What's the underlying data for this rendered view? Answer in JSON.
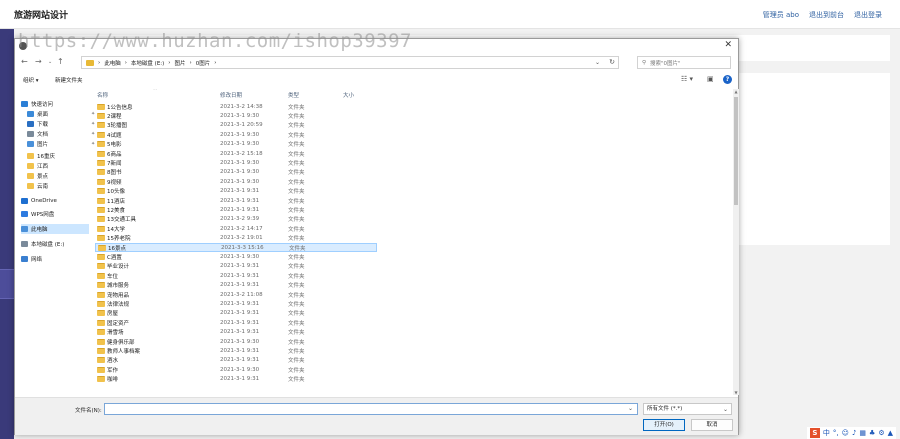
{
  "site": {
    "title": "旅游网站设计",
    "links": [
      "管理员 abo",
      "退出到前台",
      "退出登录"
    ]
  },
  "watermark": "https://www.huzhan.com/ishop39397",
  "dialog": {
    "address": {
      "crumbs": [
        "此电脑",
        "本地磁盘 (E:)",
        "图片",
        "0图片"
      ],
      "separator": "›"
    },
    "search_placeholder": "搜索\"0图片\"",
    "toolbar": {
      "organize": "组织 ▾",
      "new_folder": "新建文件夹"
    },
    "tree": [
      {
        "label": "快速访问",
        "icon": "star-icon",
        "color": "#2b7fd6",
        "indent": 0
      },
      {
        "label": "桌面",
        "icon": "desktop-icon",
        "color": "#3c8ad8",
        "indent": 1,
        "pinned": true
      },
      {
        "label": "下载",
        "icon": "download-icon",
        "color": "#2a6fc2",
        "indent": 1,
        "pinned": true
      },
      {
        "label": "文档",
        "icon": "document-icon",
        "color": "#7a8a9a",
        "indent": 1,
        "pinned": true
      },
      {
        "label": "图片",
        "icon": "picture-icon",
        "color": "#4a90d9",
        "indent": 1,
        "pinned": true
      },
      {
        "label": "16重庆",
        "icon": "folder-icon",
        "color": "#f1c24c",
        "indent": 1
      },
      {
        "label": "江西",
        "icon": "folder-icon",
        "color": "#f1c24c",
        "indent": 1
      },
      {
        "label": "景点",
        "icon": "folder-icon",
        "color": "#f1c24c",
        "indent": 1
      },
      {
        "label": "云南",
        "icon": "folder-icon",
        "color": "#f1c24c",
        "indent": 1
      },
      {
        "label": "OneDrive",
        "icon": "cloud-icon",
        "color": "#1e6fd0",
        "indent": 0
      },
      {
        "label": "WPS网盘",
        "icon": "cloud-icon",
        "color": "#2d7be0",
        "indent": 0
      },
      {
        "label": "此电脑",
        "icon": "computer-icon",
        "color": "#4a90d9",
        "indent": 0,
        "selected": true
      },
      {
        "label": "本地磁盘 (E:)",
        "icon": "drive-icon",
        "color": "#7a8a9a",
        "indent": 0
      },
      {
        "label": "网络",
        "icon": "network-icon",
        "color": "#3a7fd0",
        "indent": 0
      }
    ],
    "columns": [
      "名称",
      "修改日期",
      "类型",
      "大小"
    ],
    "rows": [
      {
        "name": "1公告信息",
        "date": "2021-3-2 14:38",
        "type": "文件夹"
      },
      {
        "name": "2课程",
        "date": "2021-3-1 9:30",
        "type": "文件夹"
      },
      {
        "name": "3轮播图",
        "date": "2021-3-1 20:59",
        "type": "文件夹"
      },
      {
        "name": "4试题",
        "date": "2021-3-1 9:30",
        "type": "文件夹"
      },
      {
        "name": "5电影",
        "date": "2021-3-1 9:30",
        "type": "文件夹"
      },
      {
        "name": "6商品",
        "date": "2021-3-2 15:18",
        "type": "文件夹"
      },
      {
        "name": "7新闻",
        "date": "2021-3-1 9:30",
        "type": "文件夹"
      },
      {
        "name": "8图书",
        "date": "2021-3-1 9:30",
        "type": "文件夹"
      },
      {
        "name": "9视频",
        "date": "2021-3-1 9:30",
        "type": "文件夹"
      },
      {
        "name": "10头像",
        "date": "2021-3-1 9:31",
        "type": "文件夹"
      },
      {
        "name": "11酒店",
        "date": "2021-3-1 9:31",
        "type": "文件夹"
      },
      {
        "name": "12美食",
        "date": "2021-3-1 9:31",
        "type": "文件夹"
      },
      {
        "name": "13交通工具",
        "date": "2021-3-2 9:39",
        "type": "文件夹"
      },
      {
        "name": "14大学",
        "date": "2021-3-2 14:17",
        "type": "文件夹"
      },
      {
        "name": "15养老院",
        "date": "2021-3-2 19:01",
        "type": "文件夹"
      },
      {
        "name": "16景点",
        "date": "2021-3-3 15:16",
        "type": "文件夹",
        "highlight": true
      },
      {
        "name": "C酒置",
        "date": "2021-3-1 9:30",
        "type": "文件夹"
      },
      {
        "name": "毕业设计",
        "date": "2021-3-1 9:31",
        "type": "文件夹"
      },
      {
        "name": "车位",
        "date": "2021-3-1 9:31",
        "type": "文件夹"
      },
      {
        "name": "城市服务",
        "date": "2021-3-1 9:31",
        "type": "文件夹"
      },
      {
        "name": "宠物用品",
        "date": "2021-3-2 11:08",
        "type": "文件夹"
      },
      {
        "name": "法律法规",
        "date": "2021-3-1 9:31",
        "type": "文件夹"
      },
      {
        "name": "房屋",
        "date": "2021-3-1 9:31",
        "type": "文件夹"
      },
      {
        "name": "固定资产",
        "date": "2021-3-1 9:31",
        "type": "文件夹"
      },
      {
        "name": "滑雪场",
        "date": "2021-3-1 9:31",
        "type": "文件夹"
      },
      {
        "name": "健身俱乐部",
        "date": "2021-3-1 9:30",
        "type": "文件夹"
      },
      {
        "name": "教师人事档案",
        "date": "2021-3-1 9:31",
        "type": "文件夹"
      },
      {
        "name": "酒水",
        "date": "2021-3-1 9:31",
        "type": "文件夹"
      },
      {
        "name": "军作",
        "date": "2021-3-1 9:30",
        "type": "文件夹"
      },
      {
        "name": "咖啡",
        "date": "2021-3-1 9:31",
        "type": "文件夹"
      }
    ],
    "filename_label": "文件名(N):",
    "filename_value": "",
    "filetype": "所有文件 (*.*)",
    "open_button": "打开(O)",
    "cancel_button": "取消"
  },
  "tray": [
    "中",
    "°,",
    "☺",
    "♪",
    "▦",
    "♣",
    "⚙",
    "▲"
  ]
}
